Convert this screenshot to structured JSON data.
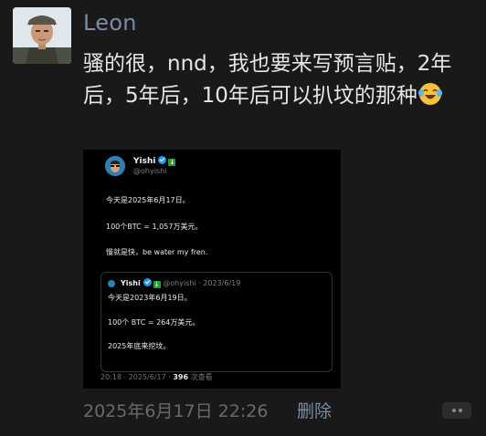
{
  "post": {
    "username": "Leon",
    "text": "骚的很，nnd，我也要来写预言贴，2年后，5年后，10年后可以扒坟的那种",
    "emoji": "tears-of-joy-emoji",
    "timestamp": "2025年6月17日 22:26",
    "delete_label": "删除"
  },
  "tweet": {
    "name": "Yishi",
    "handle": "@ohyishi",
    "lines": [
      "今天是2025年6月17日。",
      "100个BTC = 1,057万美元。",
      "慢就是快，be water my fren."
    ],
    "quote": {
      "name": "Yishi",
      "handle_date": "@ohyishi · 2023/6/19",
      "lines": [
        "今天是2023年6月19日。",
        "100个 BTC = 264万美元。",
        "2025年底来挖坟。"
      ]
    },
    "meta_prefix": "20:18 · 2025/6/17 · ",
    "meta_views": "396",
    "meta_suffix": " 次查看"
  },
  "colors": {
    "background": "#191919",
    "username": "#7b8ba6",
    "body_text": "#e6e6e6",
    "timestamp": "#6a6a6a",
    "verified": "#1d9bf0"
  }
}
